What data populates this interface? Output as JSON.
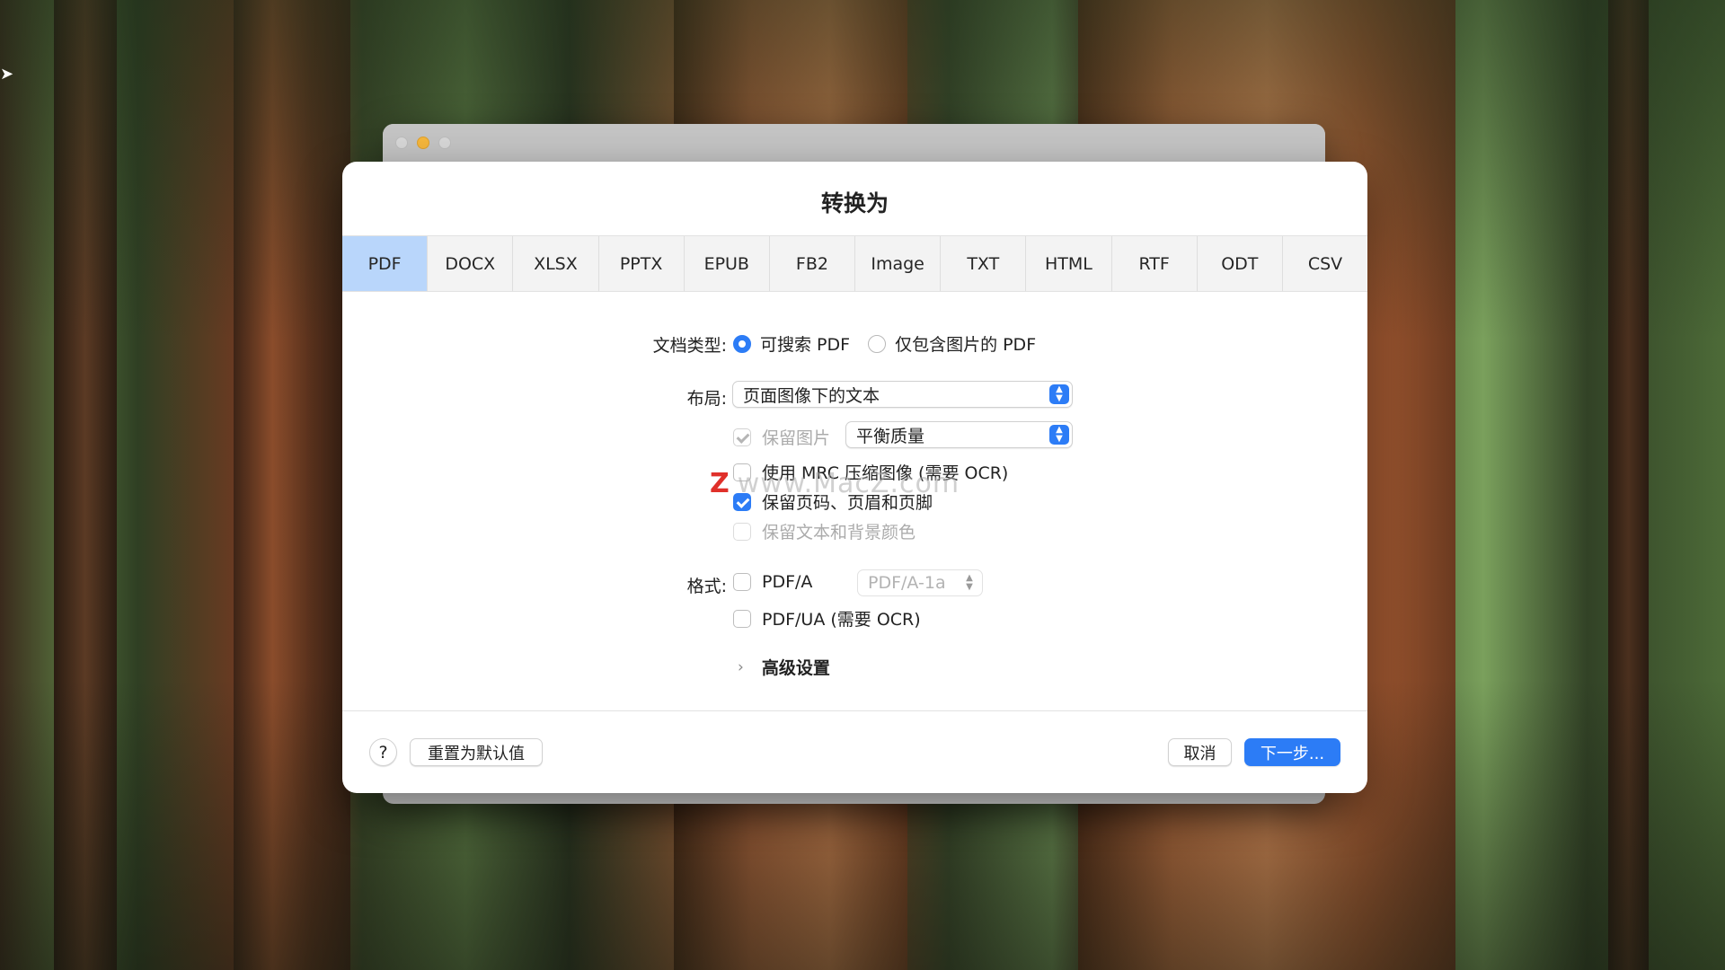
{
  "dialog": {
    "title": "转换为",
    "tabs": [
      "PDF",
      "DOCX",
      "XLSX",
      "PPTX",
      "EPUB",
      "FB2",
      "Image",
      "TXT",
      "HTML",
      "RTF",
      "ODT",
      "CSV"
    ],
    "active_tab": "PDF"
  },
  "doc_type": {
    "label": "文档类型:",
    "options": [
      "可搜索 PDF",
      "仅包含图片的 PDF"
    ],
    "selected": "可搜索 PDF"
  },
  "layout": {
    "label": "布局:",
    "value": "页面图像下的文本"
  },
  "keep_images": {
    "label": "保留图片",
    "quality_value": "平衡质量"
  },
  "options": {
    "mrc": "使用 MRC 压缩图像 (需要 OCR)",
    "keep_headers": "保留页码、页眉和页脚",
    "keep_colors": "保留文本和背景颜色"
  },
  "format": {
    "label": "格式:",
    "pdfa": "PDF/A",
    "pdfa_version": "PDF/A-1a",
    "pdfua": "PDF/UA (需要 OCR)"
  },
  "advanced": {
    "label": "高级设置",
    "chevron": "chevron-right-icon"
  },
  "footer": {
    "help": "?",
    "reset": "重置为默认值",
    "cancel": "取消",
    "next": "下一步..."
  },
  "watermark": {
    "logo": "Z",
    "text": "www.MacZ.com"
  },
  "colors": {
    "accent": "#2c7cf6",
    "active_tab": "#b9d6fb"
  }
}
